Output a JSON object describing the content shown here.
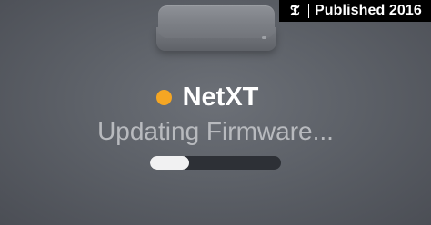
{
  "device": {
    "name": "NetXT",
    "status_color": "#f5a623",
    "icon": "router-icon"
  },
  "update": {
    "message": "Updating Firmware...",
    "progress": 0.3
  },
  "watermark": {
    "logo": "𝕿",
    "text": "Published 2016"
  },
  "colors": {
    "progress_fill": "#f1f1f2",
    "progress_track": "#2d3036"
  }
}
